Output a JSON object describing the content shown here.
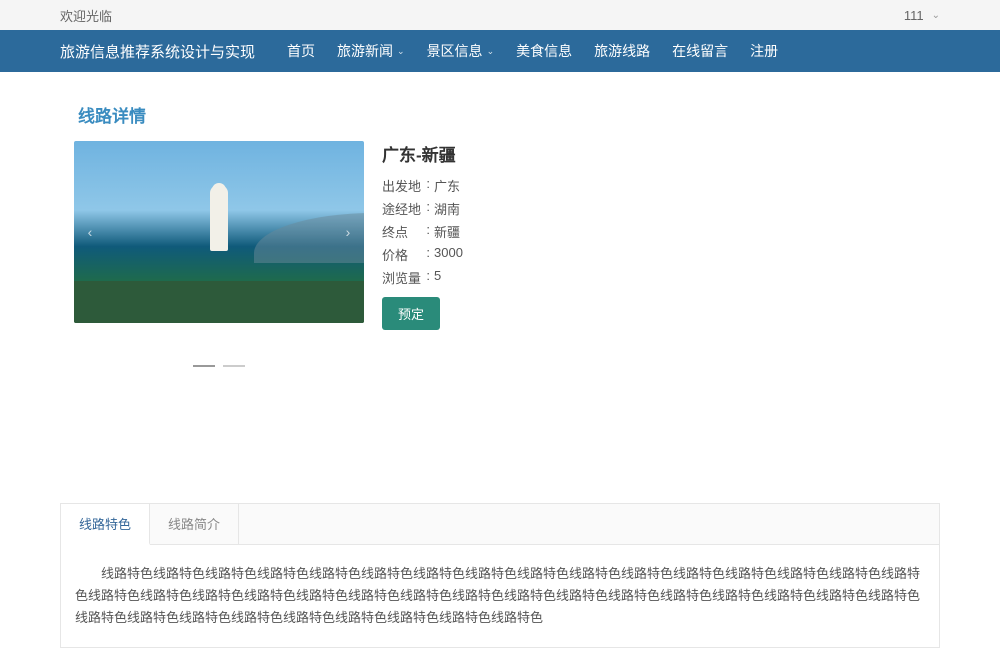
{
  "topbar": {
    "welcome": "欢迎光临",
    "user": "111"
  },
  "nav": {
    "brand": "旅游信息推荐系统设计与实现",
    "items": [
      {
        "label": "首页",
        "dd": false
      },
      {
        "label": "旅游新闻",
        "dd": true
      },
      {
        "label": "景区信息",
        "dd": true
      },
      {
        "label": "美食信息",
        "dd": false
      },
      {
        "label": "旅游线路",
        "dd": false
      },
      {
        "label": "在线留言",
        "dd": false
      },
      {
        "label": "注册",
        "dd": false
      }
    ]
  },
  "page": {
    "title": "线路详情"
  },
  "route": {
    "name": "广东-新疆",
    "fields": {
      "depart_label": "出发地",
      "depart_value": "广东",
      "via_label": "途经地",
      "via_value": "湖南",
      "dest_label": "终点",
      "dest_value": "新疆",
      "price_label": "价格",
      "price_value": "3000",
      "views_label": "浏览量",
      "views_value": "5"
    },
    "book_label": "预定"
  },
  "tabs": {
    "t1": "线路特色",
    "t2": "线路简介",
    "content": "线路特色线路特色线路特色线路特色线路特色线路特色线路特色线路特色线路特色线路特色线路特色线路特色线路特色线路特色线路特色线路特色线路特色线路特色线路特色线路特色线路特色线路特色线路特色线路特色线路特色线路特色线路特色线路特色线路特色线路特色线路特色线路特色线路特色线路特色线路特色线路特色线路特色线路特色线路特色线路特色线路特色"
  }
}
